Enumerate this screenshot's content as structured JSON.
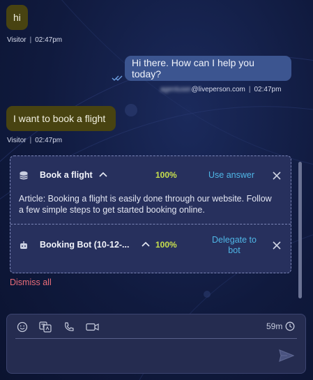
{
  "messages": [
    {
      "text": "hi",
      "sender": "Visitor",
      "time": "02:47pm"
    },
    {
      "text": "Hi there. How can I help you today?",
      "sender_masked": "agentuser",
      "sender_domain": "@liveperson.com",
      "time": "02:47pm"
    },
    {
      "text": "I want to book a flight",
      "sender": "Visitor",
      "time": "02:47pm"
    }
  ],
  "suggestions": [
    {
      "icon": "database-icon",
      "title": "Book a flight",
      "score": "100%",
      "action": "Use answer",
      "body": "Article: Booking a flight is easily done through our website. Follow a few simple steps to get started booking online."
    },
    {
      "icon": "bot-icon",
      "title": "Booking Bot (10-12-...",
      "score": "100%",
      "action": "Delegate to bot"
    }
  ],
  "dismiss_all": "Dismiss all",
  "composer": {
    "timer": "59m",
    "placeholder": "",
    "tools": [
      "emoji-icon",
      "translate-icon",
      "phone-icon",
      "video-icon"
    ]
  },
  "colors": {
    "visitor_bubble": "#484311",
    "agent_bubble": "#3c5590",
    "score": "#c8e04d",
    "link": "#4fb6e6",
    "dismiss": "#ea6d79"
  }
}
